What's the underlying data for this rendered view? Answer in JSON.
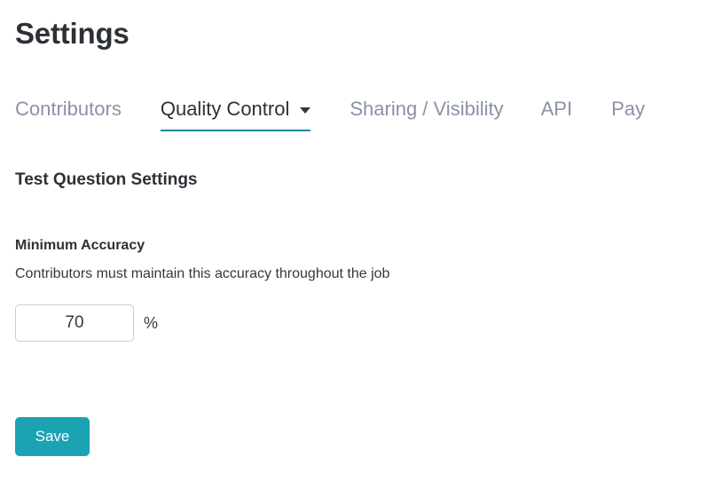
{
  "page": {
    "title": "Settings"
  },
  "tabs": [
    {
      "label": "Contributors",
      "active": false,
      "has_caret": false
    },
    {
      "label": "Quality Control",
      "active": true,
      "has_caret": true
    },
    {
      "label": "Sharing / Visibility",
      "active": false,
      "has_caret": false
    },
    {
      "label": "API",
      "active": false,
      "has_caret": false
    },
    {
      "label": "Pay",
      "active": false,
      "has_caret": false
    }
  ],
  "section": {
    "title": "Test Question Settings"
  },
  "field": {
    "label": "Minimum Accuracy",
    "help": "Contributors must maintain this accuracy throughout the job",
    "value": "70",
    "placeholder": "",
    "unit": "%"
  },
  "actions": {
    "save_label": "Save"
  },
  "colors": {
    "accent": "#1ba3b4",
    "active_tab_underline": "#1c8b9c",
    "inactive_tab_text": "#8a92a6",
    "heading_text": "#2d3136",
    "body_text": "#33383d",
    "input_border": "#c8cad6",
    "background": "#ffffff"
  },
  "icons": {
    "caret_down": "chevron-down-icon"
  }
}
